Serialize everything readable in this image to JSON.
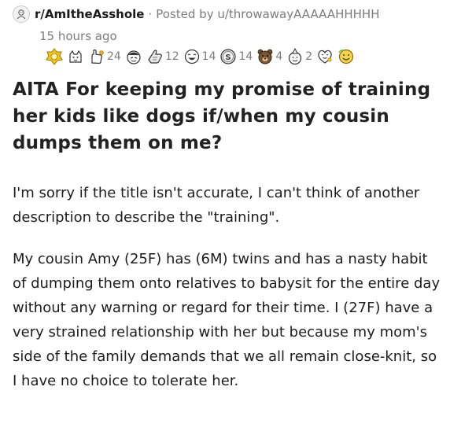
{
  "header": {
    "subreddit": "r/AmItheAsshole",
    "separator": "·",
    "posted_by_prefix": "Posted by",
    "username": "u/throwawayAAAAAHHHHH",
    "time": "15 hours ago"
  },
  "awards": [
    {
      "icon": "gold-badge-icon",
      "count": ""
    },
    {
      "icon": "wholesome-cat-icon",
      "count": ""
    },
    {
      "icon": "helpful-hand-icon",
      "count": "24"
    },
    {
      "icon": "facepalm-face-icon",
      "count": ""
    },
    {
      "icon": "silver-hand-icon",
      "count": "12"
    },
    {
      "icon": "laughing-face-icon",
      "count": "14"
    },
    {
      "icon": "silver-coin-icon",
      "count": "14"
    },
    {
      "icon": "bear-icon",
      "count": "4"
    },
    {
      "icon": "party-face-icon",
      "count": "2"
    },
    {
      "icon": "heart-face-icon",
      "count": ""
    },
    {
      "icon": "gold-coin-smile-icon",
      "count": ""
    }
  ],
  "post": {
    "title": "AITA For keeping my promise of training her kids like dogs if/when my cousin dumps them on me?",
    "paragraphs": [
      "I'm sorry if the title isn't accurate, I can't think of another description to describe the \"training\".",
      "My cousin Amy (25F) has (6M) twins and has a nasty habit of dumping them onto relatives to babysit for the entire day without any warning or regard for their time. I (27F) have a very strained relationship with her but because my mom's side of the family demands that we all remain close-knit, so I have no choice to tolerate her."
    ]
  },
  "colors": {
    "text": "#1a1a1b",
    "meta": "#7c7c7c",
    "gold": "#f5c518"
  }
}
